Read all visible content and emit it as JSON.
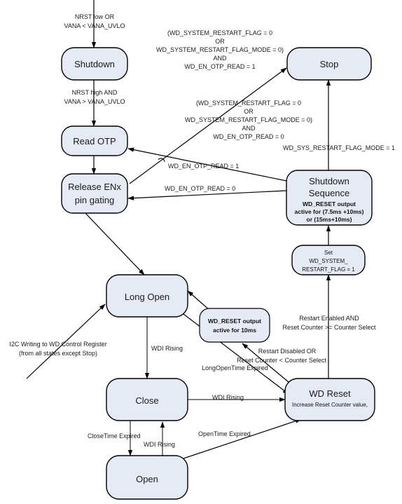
{
  "diagram": {
    "title": "Watchdog State Machine Diagram",
    "colors": {
      "node_fill": "#e6eaf4",
      "node_stroke": "#000000",
      "text": "#1a1a1a",
      "background": "#ffffff"
    },
    "nodes": {
      "shutdown": {
        "label": "Shutdown"
      },
      "stop": {
        "label": "Stop"
      },
      "read_otp": {
        "label": "Read OTP"
      },
      "release_enx": {
        "line1": "Release ENx",
        "line2": "pin gating"
      },
      "shutdown_sequence": {
        "line1": "Shutdown",
        "line2": "Sequence",
        "detail1": "WD_RESET output",
        "detail2": "active for (7.5ms +10ms)",
        "detail3": "or (15ms+10ms)"
      },
      "set_flag": {
        "line1": "Set",
        "line2": "WD_SYSTEM_",
        "line3": "RESTART_FLAG = 1"
      },
      "long_open": {
        "label": "Long Open"
      },
      "wd_reset_output": {
        "line1": "WD_RESET output",
        "line2": "active for 10ms"
      },
      "close": {
        "label": "Close"
      },
      "open": {
        "label": "Open"
      },
      "wd_reset": {
        "label": "WD Reset",
        "detail": "Increase Reset Counter value,"
      }
    },
    "edge_labels": {
      "nrst_low": {
        "line1": "NRST low OR",
        "line2": "VANA < VANA_UVLO"
      },
      "nrst_high": {
        "line1": "NRST high AND",
        "line2": "VANA > VANA_UVLO"
      },
      "cond_stop": {
        "line1": "(WD_SYSTEM_RESTART_FLAG = 0",
        "line2": "OR",
        "line3": "WD_SYSTEM_RESTART_FLAG_MODE = 0)",
        "line4": "AND",
        "line5": "WD_EN_OTP_READ = 1"
      },
      "cond_readotp": {
        "line1": "(WD_SYSTEM_RESTART_FLAG = 0",
        "line2": "OR",
        "line3": "WD_SYSTEM_RESTART_FLAG_MODE = 0)",
        "line4": "AND",
        "line5": "WD_EN_OTP_READ = 0"
      },
      "restart_flag_mode_1": "WD_SYS_RESTART_FLAG_MODE = 1",
      "otp_read_1": "WD_EN_OTP_READ = 1",
      "otp_read_0": "WD_EN_OTP_READ = 0",
      "i2c_write": {
        "line1": "I2C Writing to WD Control Register",
        "line2": "(from all states except Stop)"
      },
      "wdi_rising_longopen": "WDI Rising",
      "wdi_rising_close": "WDI Rising",
      "wdi_rising_open": "WDI Rising",
      "close_time_expired": "CloseTime Expired",
      "open_time_expired": "OpenTime Expired",
      "long_open_time_expired": "LongOpenTime Expired",
      "restart_enabled": {
        "line1": "Restart Enabled AND",
        "line2": "Reset Counter >= Counter Select"
      },
      "restart_disabled": {
        "line1": "Restart Disabled OR",
        "line2": "Reset Counter < Counter Select"
      }
    }
  }
}
